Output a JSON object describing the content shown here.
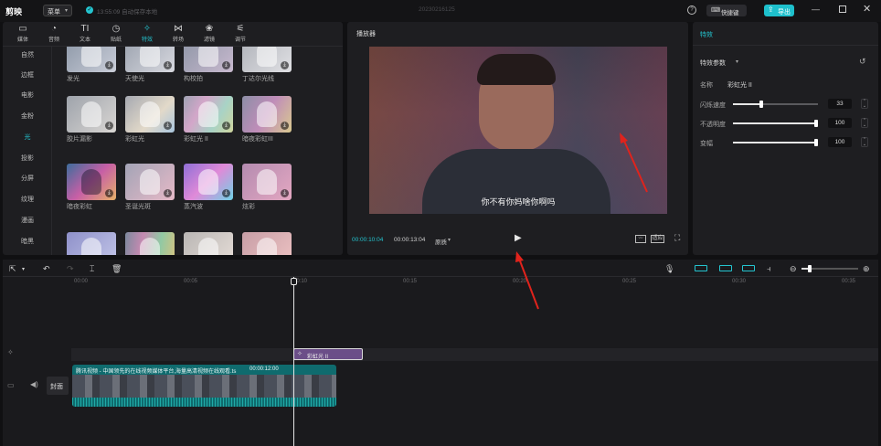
{
  "app": {
    "name": "剪映",
    "menu_label": "菜单",
    "save_status": "13:55:09 自动保存本地",
    "project_name": "20230216125"
  },
  "titlebar": {
    "shortcut_label": "快捷键",
    "export_label": "导出"
  },
  "toolbar_tabs": [
    {
      "label": "媒体",
      "icon": "media-icon"
    },
    {
      "label": "音频",
      "icon": "audio-icon"
    },
    {
      "label": "文本",
      "icon": "text-icon"
    },
    {
      "label": "贴纸",
      "icon": "sticker-icon"
    },
    {
      "label": "特效",
      "icon": "effects-icon",
      "active": true
    },
    {
      "label": "转场",
      "icon": "transition-icon"
    },
    {
      "label": "滤镜",
      "icon": "filter-icon"
    },
    {
      "label": "调节",
      "icon": "adjust-icon"
    }
  ],
  "categories": [
    "自然",
    "边框",
    "电影",
    "金粉",
    "光",
    "投影",
    "分屏",
    "纹理",
    "漫画",
    "暗黑"
  ],
  "active_category": "光",
  "effect_rows": [
    [
      "发光",
      "天使光",
      "构校拍",
      "丁达尔光线"
    ],
    [
      "胶片漏影",
      "彩虹光",
      "彩虹光 II",
      "暗夜彩虹III"
    ],
    [
      "暗夜彩虹",
      "圣诞光斑",
      "蒸汽波",
      "炫彩"
    ]
  ],
  "player": {
    "title": "播放器",
    "subtitle": "你不有你妈啥你啊吗",
    "current_time": "00:00:10:04",
    "total_time": "00:00:13:04",
    "quality_label": "原质",
    "ratio_label": "适应"
  },
  "props": {
    "tab": "特效",
    "section_title": "特效参数",
    "name_label": "名称",
    "name_value": "彩虹光 II",
    "params": [
      {
        "label": "闪烁速度",
        "value": "33",
        "percent": 33
      },
      {
        "label": "不透明度",
        "value": "100",
        "percent": 100
      },
      {
        "label": "变幅",
        "value": "100",
        "percent": 100
      }
    ]
  },
  "timeline": {
    "ticks": [
      "00:00",
      "00:05",
      "00:10",
      "00:15",
      "00:20",
      "00:25",
      "00:30",
      "00:35"
    ],
    "effect_clip_label": "彩虹光 II",
    "video_clip_label": "腾讯视频 - 中国领先的在线视频媒体平台,海量高清视频在线观看.ts",
    "video_clip_duration": "00:00:12:00",
    "cover_label": "封面"
  },
  "colors": {
    "accent": "#24c4cf",
    "effect_clip": "#6b4e88",
    "video_clip": "#0f6b6e",
    "arrow": "#e0231c"
  }
}
